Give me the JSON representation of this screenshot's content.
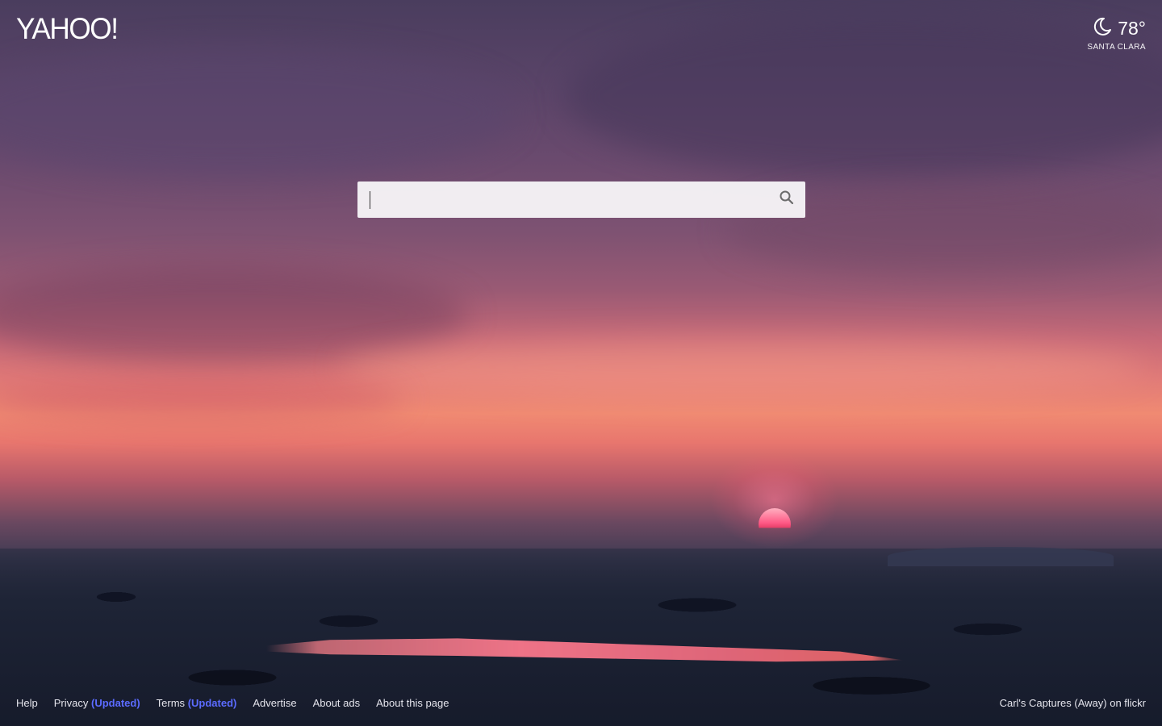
{
  "brand": {
    "logo_text": "YAHOO!"
  },
  "weather": {
    "temperature": "78°",
    "city": "SANTA CLARA",
    "icon": "moon-icon"
  },
  "search": {
    "value": "",
    "placeholder": "",
    "button_icon": "search-icon"
  },
  "footer": {
    "links": [
      {
        "label": "Help"
      },
      {
        "label": "Privacy",
        "badge": "(Updated)"
      },
      {
        "label": "Terms",
        "badge": "(Updated)"
      },
      {
        "label": "Advertise"
      },
      {
        "label": "About ads"
      },
      {
        "label": "About this page"
      }
    ],
    "photo_credit": "Carl's Captures (Away) on flickr"
  },
  "colors": {
    "updated_badge": "#5b6bff",
    "search_bg": "#f5f3f6",
    "text_light": "#e4e4ec"
  }
}
